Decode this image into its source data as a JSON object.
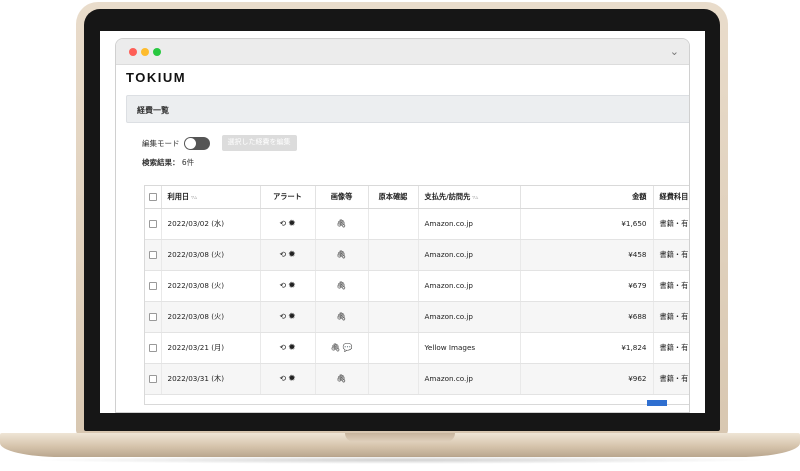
{
  "app": {
    "logo": "TOKIUM"
  },
  "page": {
    "section_title": "経費一覧"
  },
  "controls": {
    "edit_mode_label": "編集モード",
    "edit_mode_on": false,
    "edit_selected_button": "選択した経費を編集"
  },
  "results": {
    "label": "検索結果：",
    "count": "6件"
  },
  "table": {
    "headers": {
      "date": "利用日",
      "alert": "アラート",
      "images": "画像等",
      "original": "原本確認",
      "payee": "支払先/訪問先",
      "amount": "金額",
      "category": "経費科目"
    },
    "sort_marker": "▿▵",
    "rows": [
      {
        "date": "2022/03/02 (水)",
        "alert_icons": [
          "history-icon",
          "star-badge-icon"
        ],
        "image_icons": [
          "paperclip-icon"
        ],
        "payee": "Amazon.co.jp",
        "amount": "¥1,650",
        "category": "書籍・有"
      },
      {
        "date": "2022/03/08 (火)",
        "alert_icons": [
          "history-icon",
          "star-badge-icon"
        ],
        "image_icons": [
          "paperclip-icon"
        ],
        "payee": "Amazon.co.jp",
        "amount": "¥458",
        "category": "書籍・有"
      },
      {
        "date": "2022/03/08 (火)",
        "alert_icons": [
          "history-icon",
          "star-badge-icon"
        ],
        "image_icons": [
          "paperclip-icon"
        ],
        "payee": "Amazon.co.jp",
        "amount": "¥679",
        "category": "書籍・有"
      },
      {
        "date": "2022/03/08 (火)",
        "alert_icons": [
          "history-icon",
          "star-badge-icon"
        ],
        "image_icons": [
          "paperclip-icon"
        ],
        "payee": "Amazon.co.jp",
        "amount": "¥688",
        "category": "書籍・有"
      },
      {
        "date": "2022/03/21 (月)",
        "alert_icons": [
          "history-icon",
          "star-badge-icon"
        ],
        "image_icons": [
          "paperclip-icon",
          "comment-icon"
        ],
        "payee": "Yellow Images",
        "amount": "¥1,824",
        "category": "書籍・有"
      },
      {
        "date": "2022/03/31 (木)",
        "alert_icons": [
          "history-icon",
          "star-badge-icon"
        ],
        "image_icons": [
          "paperclip-icon"
        ],
        "payee": "Amazon.co.jp",
        "amount": "¥962",
        "category": "書籍・有"
      }
    ]
  },
  "colors": {
    "window_dot_red": "#fe5f57",
    "window_dot_yellow": "#febc2e",
    "window_dot_green": "#28c840",
    "accent_blue": "#2f6fd0"
  }
}
